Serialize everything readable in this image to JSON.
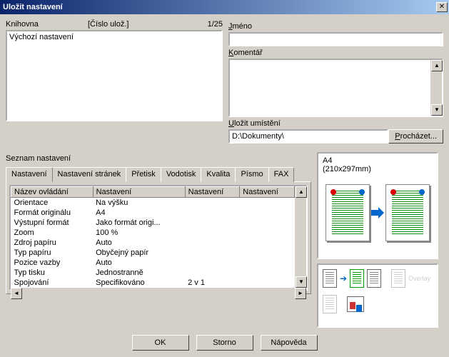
{
  "title": "Uložit nastavení",
  "library": {
    "header": "Knihovna",
    "sub": "[Číslo ulož.]",
    "count": "1/25",
    "selected": "Výchozí nastavení"
  },
  "name": {
    "label": "Jméno",
    "value": ""
  },
  "comment": {
    "label": "Komentář",
    "value": ""
  },
  "saveLocation": {
    "label": "Uložit umístění",
    "path": "D:\\Dokumenty\\",
    "browse": "Procházet..."
  },
  "settingsList": {
    "label": "Seznam nastavení",
    "tabs": [
      "Nastavení",
      "Nastavení stránek",
      "Přetisk",
      "Vodotisk",
      "Kvalita",
      "Písmo",
      "FAX"
    ],
    "headers": [
      "Název ovládání",
      "Nastavení",
      "Nastavení",
      "Nastavení"
    ],
    "rows": [
      [
        "Orientace",
        "Na výšku",
        "",
        ""
      ],
      [
        "Formát originálu",
        "A4",
        "",
        ""
      ],
      [
        "Výstupní formát",
        "Jako formát origi...",
        "",
        ""
      ],
      [
        "Zoom",
        "100 %",
        "",
        ""
      ],
      [
        "Zdroj papíru",
        "Auto",
        "",
        ""
      ],
      [
        "Typ papíru",
        "Obyčejný papír",
        "",
        ""
      ],
      [
        "Pozice vazby",
        "Auto",
        "",
        ""
      ],
      [
        "Typ tisku",
        "Jednostranně",
        "",
        ""
      ],
      [
        "Spojování",
        "Specifikováno",
        "2 v 1",
        ""
      ]
    ]
  },
  "preview": {
    "title": "A4",
    "size": "(210x297mm)",
    "overlay_label": "Overlay"
  },
  "buttons": {
    "ok": "OK",
    "cancel": "Storno",
    "help": "Nápověda"
  }
}
